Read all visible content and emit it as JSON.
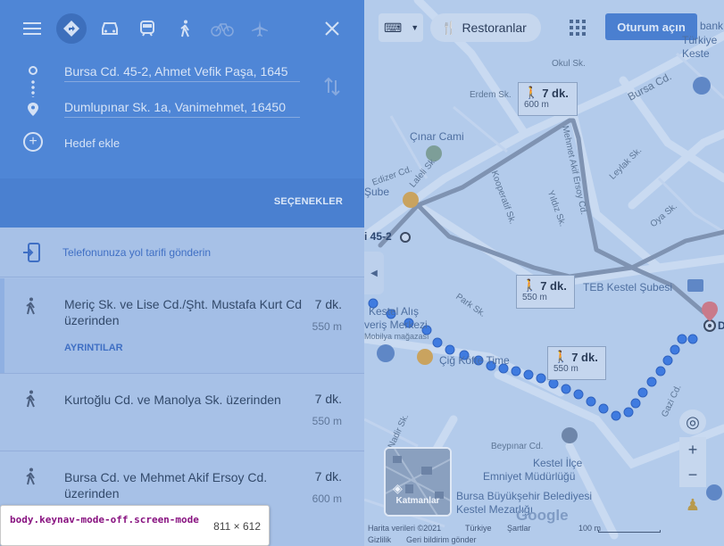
{
  "toolbar": {
    "modes": [
      "menu-icon",
      "directions-icon",
      "car-icon",
      "transit-icon",
      "walk-icon",
      "bicycle-icon",
      "flight-icon"
    ],
    "close_icon": "close-icon"
  },
  "route_inputs": {
    "origin": "Bursa Cd. 45-2, Ahmet Vefik Paşa, 1645",
    "destination": "Dumlupınar Sk. 1a, Vanimehmet, 16450",
    "add_destination": "Hedef ekle"
  },
  "options_label": "SEÇENEKLER",
  "send_directions": "Telefonunuza yol tarifi gönderin",
  "routes": [
    {
      "title": "Meriç Sk. ve Lise Cd./Şht. Mustafa Kurt Cd üzerinden",
      "minutes": "7 dk.",
      "distance": "550 m",
      "details": "AYRINTILAR"
    },
    {
      "title": "Kurtoğlu Cd. ve Manolya Sk. üzerinden",
      "minutes": "7 dk.",
      "distance": "550 m"
    },
    {
      "title": "Bursa Cd. ve Mehmet Akif Ersoy Cd. üzerinden",
      "minutes": "7 dk.",
      "distance": "600 m"
    }
  ],
  "map": {
    "restaurants_chip": "Restoranlar",
    "sign_in": "Oturum açın",
    "layers": "Katmanlar",
    "walk_boxes": [
      {
        "time": "7 dk.",
        "dist": "600 m"
      },
      {
        "time": "7 dk.",
        "dist": "550 m"
      },
      {
        "time": "7 dk.",
        "dist": "550 m"
      }
    ],
    "labels": {
      "okul": "Okul Sk.",
      "bursa_cd": "Bursa Cd.",
      "erdem": "Erdem Sk.",
      "cinar": "Çınar Cami",
      "edizer": "Edizer Cd.",
      "laleli": "Laleli Sk.",
      "kooperatif": "Kooperatif Sk.",
      "mehmet_akif": "Mehmet Akif Ersoy Cd.",
      "leylak": "Leylak Sk.",
      "yildiz": "Yıldız Sk.",
      "oya": "Oya Sk.",
      "park": "Park Sk.",
      "sube": "Şube",
      "addr45": "i 45-2",
      "teb": "TEB Kestel Şubesi",
      "alisveris": "Kestel Alış",
      "merkezi": "veriş Merkezi",
      "mobilya": "Mobilya mağazası",
      "cig": "Çiğ Köfte Time",
      "nadir": "Nadir Sk.",
      "gazi": "Gazi Cd.",
      "beypinar": "Beypınar Cd.",
      "emniyet1": "Kestel İlçe",
      "emniyet2": "Emniyet Müdürlüğü",
      "belediye1": "Bursa Büyükşehir Belediyesi",
      "belediye2": "Kestel Mezarlığı",
      "turkiye": "Türkiye",
      "kestel": "Keste",
      "bank": "bank",
      "d": "D"
    },
    "attribution": {
      "data": "Harita verileri ©2021",
      "country": "Türkiye",
      "terms": "Şartlar",
      "scale": "100 m",
      "privacy": "Gizlilik",
      "feedback": "Geri bildirim gönder"
    },
    "google": "Google"
  },
  "devtools_tooltip": {
    "selector": "body.keynav-mode-off.screen-mode",
    "size": "811 × 612"
  },
  "colors": {
    "header": "#4f86d6",
    "panel": "#a7c1e7",
    "map": "#b3cbeb",
    "route_dots": "#3f7be0"
  }
}
